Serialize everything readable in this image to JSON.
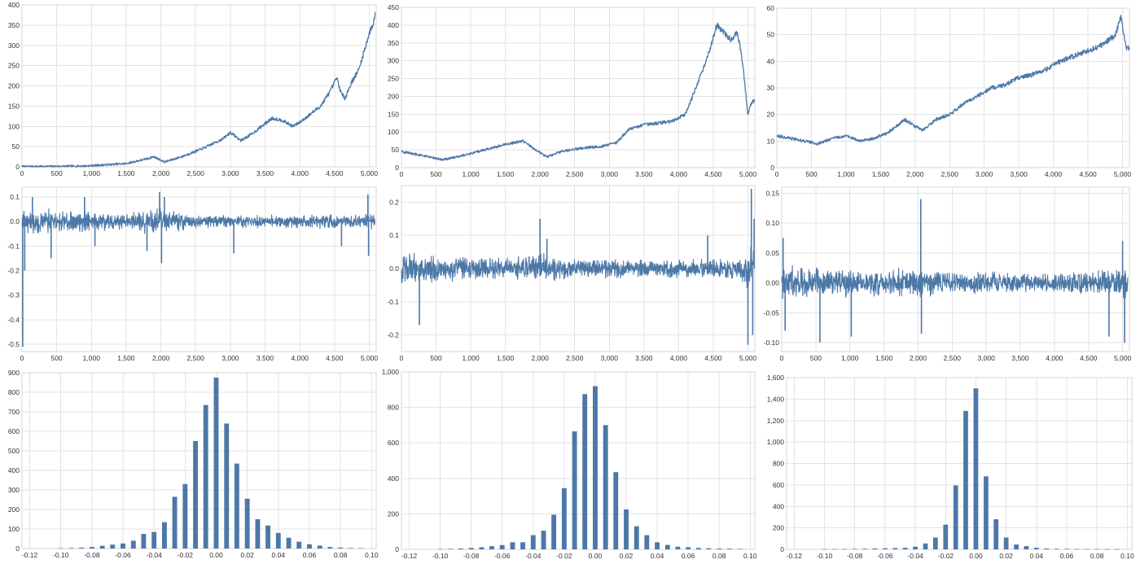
{
  "colors": {
    "series": "#4c78a8",
    "grid": "#e3e3e3",
    "frame": "#d6d6d6",
    "tick_text": "#333333"
  },
  "chart_data": [
    {
      "type": "line",
      "title": "",
      "xlabel": "",
      "ylabel": "",
      "grid": true,
      "xlim": [
        0,
        5100
      ],
      "ylim": [
        0,
        400
      ],
      "xticks": [
        0,
        500,
        1000,
        1500,
        2000,
        2500,
        3000,
        3500,
        4000,
        4500,
        5000
      ],
      "xtick_labels": [
        "0",
        "500",
        "1,000",
        "1,500",
        "2,000",
        "2,500",
        "3,000",
        "3,500",
        "4,000",
        "4,500",
        "5,000"
      ],
      "yticks": [
        0,
        50,
        100,
        150,
        200,
        250,
        300,
        350,
        400
      ],
      "ytick_labels": [
        "0",
        "50",
        "100",
        "150",
        "200",
        "250",
        "300",
        "350",
        "400"
      ],
      "x": [
        0,
        300,
        600,
        900,
        1200,
        1500,
        1800,
        1900,
        2050,
        2300,
        2600,
        2900,
        3000,
        3150,
        3300,
        3450,
        3600,
        3750,
        3900,
        4000,
        4150,
        4300,
        4450,
        4530,
        4600,
        4650,
        4750,
        4850,
        4950,
        5000,
        5050,
        5090
      ],
      "series": [
        {
          "values": [
            1,
            1,
            1.5,
            2,
            5,
            8,
            20,
            25,
            12,
            25,
            45,
            70,
            85,
            65,
            80,
            100,
            120,
            115,
            100,
            110,
            130,
            150,
            190,
            220,
            180,
            170,
            210,
            240,
            300,
            330,
            350,
            380
          ]
        }
      ]
    },
    {
      "type": "line",
      "title": "",
      "xlabel": "",
      "ylabel": "",
      "grid": true,
      "xlim": [
        0,
        5100
      ],
      "ylim": [
        0,
        450
      ],
      "xticks": [
        0,
        500,
        1000,
        1500,
        2000,
        2500,
        3000,
        3500,
        4000,
        4500,
        5000
      ],
      "xtick_labels": [
        "0",
        "500",
        "1,000",
        "1,500",
        "2,000",
        "2,500",
        "3,000",
        "3,500",
        "4,000",
        "4,500",
        "5,000"
      ],
      "yticks": [
        0,
        50,
        100,
        150,
        200,
        250,
        300,
        350,
        400,
        450
      ],
      "ytick_labels": [
        "0",
        "50",
        "100",
        "150",
        "200",
        "250",
        "300",
        "350",
        "400",
        "450"
      ],
      "x": [
        0,
        200,
        400,
        600,
        900,
        1200,
        1500,
        1750,
        1900,
        2100,
        2300,
        2600,
        2900,
        3100,
        3300,
        3500,
        3700,
        3900,
        4100,
        4300,
        4450,
        4550,
        4650,
        4750,
        4850,
        4920,
        5000,
        5050,
        5100
      ],
      "series": [
        {
          "values": [
            45,
            38,
            30,
            22,
            35,
            50,
            65,
            75,
            55,
            30,
            45,
            55,
            60,
            70,
            110,
            120,
            125,
            130,
            150,
            250,
            330,
            400,
            380,
            360,
            380,
            300,
            150,
            180,
            190
          ]
        }
      ]
    },
    {
      "type": "line",
      "title": "",
      "xlabel": "",
      "ylabel": "",
      "grid": true,
      "xlim": [
        0,
        5100
      ],
      "ylim": [
        0,
        60
      ],
      "xticks": [
        0,
        500,
        1000,
        1500,
        2000,
        2500,
        3000,
        3500,
        4000,
        4500,
        5000
      ],
      "xtick_labels": [
        "0",
        "500",
        "1,000",
        "1,500",
        "2,000",
        "2,500",
        "3,000",
        "3,500",
        "4,000",
        "4,500",
        "5,000"
      ],
      "yticks": [
        0,
        10,
        20,
        30,
        40,
        50,
        60
      ],
      "ytick_labels": [
        "0",
        "10",
        "20",
        "30",
        "40",
        "50",
        "60"
      ],
      "x": [
        0,
        200,
        400,
        600,
        800,
        1000,
        1200,
        1400,
        1600,
        1850,
        2100,
        2300,
        2500,
        2700,
        2900,
        3100,
        3300,
        3500,
        3700,
        3900,
        4100,
        4300,
        4500,
        4700,
        4900,
        4980,
        5050,
        5100
      ],
      "series": [
        {
          "values": [
            12,
            11,
            10,
            9,
            11,
            12,
            10,
            11,
            13,
            18,
            14,
            18,
            20,
            24,
            27,
            30,
            31,
            34,
            35,
            37,
            40,
            42,
            44,
            46,
            50,
            57,
            45,
            45
          ]
        }
      ]
    },
    {
      "type": "line",
      "title": "",
      "xlabel": "",
      "ylabel": "",
      "grid": true,
      "xlim": [
        0,
        5100
      ],
      "ylim": [
        -0.53,
        0.14
      ],
      "xticks": [
        0,
        500,
        1000,
        1500,
        2000,
        2500,
        3000,
        3500,
        4000,
        4500,
        5000
      ],
      "xtick_labels": [
        "0",
        "500",
        "1,000",
        "1,500",
        "2,000",
        "2,500",
        "3,000",
        "3,500",
        "4,000",
        "4,500",
        "5,000"
      ],
      "yticks": [
        -0.5,
        -0.4,
        -0.3,
        -0.2,
        -0.1,
        0.0,
        0.1
      ],
      "ytick_labels": [
        "-0.5",
        "-0.4",
        "-0.3",
        "-0.2",
        "-0.1",
        "0.0",
        "0.1"
      ],
      "band": {
        "x": [
          0,
          500,
          1000,
          1500,
          2000,
          2100,
          2500,
          3000,
          3500,
          4000,
          4500,
          5100
        ],
        "amplitude": [
          0.06,
          0.05,
          0.045,
          0.04,
          0.06,
          0.05,
          0.03,
          0.028,
          0.028,
          0.028,
          0.03,
          0.035
        ]
      },
      "spikes": [
        {
          "x": 10,
          "value": -0.51
        },
        {
          "x": 40,
          "value": -0.2
        },
        {
          "x": 150,
          "value": 0.1
        },
        {
          "x": 420,
          "value": -0.15
        },
        {
          "x": 900,
          "value": 0.1
        },
        {
          "x": 1050,
          "value": -0.1
        },
        {
          "x": 1800,
          "value": -0.12
        },
        {
          "x": 1980,
          "value": 0.12
        },
        {
          "x": 2010,
          "value": -0.17
        },
        {
          "x": 2050,
          "value": 0.1
        },
        {
          "x": 3050,
          "value": -0.13
        },
        {
          "x": 4600,
          "value": -0.1
        },
        {
          "x": 4980,
          "value": 0.11
        },
        {
          "x": 4990,
          "value": -0.14
        }
      ],
      "series": [
        {
          "values": []
        }
      ]
    },
    {
      "type": "line",
      "title": "",
      "xlabel": "",
      "ylabel": "",
      "grid": true,
      "xlim": [
        0,
        5100
      ],
      "ylim": [
        -0.25,
        0.25
      ],
      "xticks": [
        0,
        500,
        1000,
        1500,
        2000,
        2500,
        3000,
        3500,
        4000,
        4500,
        5000
      ],
      "xtick_labels": [
        "0",
        "500",
        "1,000",
        "1,500",
        "2,000",
        "2,500",
        "3,000",
        "3,500",
        "4,000",
        "4,500",
        "5,000"
      ],
      "yticks": [
        -0.2,
        -0.1,
        0.0,
        0.1,
        0.2
      ],
      "ytick_labels": [
        "-0.2",
        "-0.1",
        "0.0",
        "0.1",
        "0.2"
      ],
      "band": {
        "x": [
          0,
          500,
          1000,
          1500,
          2000,
          2200,
          2500,
          3000,
          3500,
          4000,
          4500,
          4900,
          5000,
          5100
        ],
        "amplitude": [
          0.06,
          0.045,
          0.04,
          0.035,
          0.05,
          0.04,
          0.03,
          0.03,
          0.03,
          0.03,
          0.03,
          0.04,
          0.09,
          0.06
        ]
      },
      "spikes": [
        {
          "x": 260,
          "value": -0.17
        },
        {
          "x": 2000,
          "value": 0.15
        },
        {
          "x": 2100,
          "value": 0.09
        },
        {
          "x": 4420,
          "value": 0.1
        },
        {
          "x": 5000,
          "value": -0.23
        },
        {
          "x": 5050,
          "value": 0.24
        },
        {
          "x": 5070,
          "value": -0.2
        },
        {
          "x": 5090,
          "value": 0.15
        }
      ],
      "series": [
        {
          "values": []
        }
      ]
    },
    {
      "type": "line",
      "title": "",
      "xlabel": "",
      "ylabel": "",
      "grid": true,
      "xlim": [
        0,
        5100
      ],
      "ylim": [
        -0.115,
        0.16
      ],
      "xticks": [
        0,
        500,
        1000,
        1500,
        2000,
        2500,
        3000,
        3500,
        4000,
        4500,
        5000
      ],
      "xtick_labels": [
        "0",
        "500",
        "1,000",
        "1,500",
        "2,000",
        "2,500",
        "3,000",
        "3,500",
        "4,000",
        "4,500",
        "5,000"
      ],
      "yticks": [
        -0.1,
        -0.05,
        0.0,
        0.05,
        0.1,
        0.15
      ],
      "ytick_labels": [
        "-0.10",
        "-0.05",
        "0.00",
        "0.05",
        "0.10",
        "0.15"
      ],
      "band": {
        "x": [
          0,
          500,
          1000,
          1500,
          2000,
          2100,
          2500,
          3000,
          3500,
          4000,
          4500,
          5100
        ],
        "amplitude": [
          0.035,
          0.03,
          0.025,
          0.022,
          0.03,
          0.025,
          0.02,
          0.02,
          0.018,
          0.018,
          0.02,
          0.03
        ]
      },
      "spikes": [
        {
          "x": 20,
          "value": 0.075
        },
        {
          "x": 50,
          "value": -0.08
        },
        {
          "x": 560,
          "value": -0.1
        },
        {
          "x": 1020,
          "value": -0.09
        },
        {
          "x": 2040,
          "value": 0.14
        },
        {
          "x": 2050,
          "value": -0.085
        },
        {
          "x": 4800,
          "value": -0.09
        },
        {
          "x": 5000,
          "value": 0.07
        },
        {
          "x": 5030,
          "value": -0.1
        }
      ],
      "series": [
        {
          "values": []
        }
      ]
    },
    {
      "type": "bar",
      "title": "",
      "xlabel": "",
      "ylabel": "",
      "grid": true,
      "xlim": [
        -0.125,
        0.103
      ],
      "ylim": [
        0,
        900
      ],
      "xticks": [
        -0.12,
        -0.1,
        -0.08,
        -0.06,
        -0.04,
        -0.02,
        0.0,
        0.02,
        0.04,
        0.06,
        0.08,
        0.1
      ],
      "xtick_labels": [
        "-0.12",
        "-0.10",
        "-0.08",
        "-0.06",
        "-0.04",
        "-0.02",
        "0.00",
        "0.02",
        "0.04",
        "0.06",
        "0.08",
        "0.10"
      ],
      "yticks": [
        0,
        100,
        200,
        300,
        400,
        500,
        600,
        700,
        800,
        900
      ],
      "ytick_labels": [
        "0",
        "100",
        "200",
        "300",
        "400",
        "500",
        "600",
        "700",
        "800",
        "900"
      ],
      "bin_width": 0.0067,
      "x": [
        -0.1,
        -0.0933,
        -0.0867,
        -0.08,
        -0.0733,
        -0.0667,
        -0.06,
        -0.0533,
        -0.0467,
        -0.04,
        -0.0333,
        -0.0267,
        -0.02,
        -0.0133,
        -0.0067,
        0.0,
        0.0067,
        0.0133,
        0.02,
        0.0267,
        0.0333,
        0.04,
        0.0467,
        0.0533,
        0.06,
        0.0667,
        0.0733,
        0.08,
        0.0867,
        0.0933
      ],
      "series": [
        {
          "values": [
            2,
            3,
            5,
            8,
            14,
            20,
            26,
            40,
            75,
            85,
            135,
            265,
            330,
            550,
            735,
            875,
            640,
            435,
            255,
            150,
            118,
            80,
            55,
            35,
            22,
            15,
            8,
            5,
            3,
            2
          ]
        }
      ]
    },
    {
      "type": "bar",
      "title": "",
      "xlabel": "",
      "ylabel": "",
      "grid": true,
      "xlim": [
        -0.125,
        0.103
      ],
      "ylim": [
        0,
        1000
      ],
      "xticks": [
        -0.12,
        -0.1,
        -0.08,
        -0.06,
        -0.04,
        -0.02,
        0.0,
        0.02,
        0.04,
        0.06,
        0.08,
        0.1
      ],
      "xtick_labels": [
        "-0.12",
        "-0.10",
        "-0.08",
        "-0.06",
        "-0.04",
        "-0.02",
        "0.00",
        "0.02",
        "0.04",
        "0.06",
        "0.08",
        "0.10"
      ],
      "yticks": [
        0,
        200,
        400,
        600,
        800,
        1000
      ],
      "ytick_labels": [
        "0",
        "200",
        "400",
        "600",
        "800",
        "1,000"
      ],
      "bin_width": 0.0067,
      "x": [
        -0.1,
        -0.0933,
        -0.0867,
        -0.08,
        -0.0733,
        -0.0667,
        -0.06,
        -0.0533,
        -0.0467,
        -0.04,
        -0.0333,
        -0.0267,
        -0.02,
        -0.0133,
        -0.0067,
        0.0,
        0.0067,
        0.0133,
        0.02,
        0.0267,
        0.0333,
        0.04,
        0.0467,
        0.0533,
        0.06,
        0.0667,
        0.0733,
        0.08,
        0.0867,
        0.0933
      ],
      "series": [
        {
          "values": [
            2,
            3,
            5,
            8,
            12,
            18,
            24,
            40,
            40,
            80,
            105,
            195,
            345,
            665,
            875,
            920,
            700,
            435,
            225,
            130,
            80,
            40,
            25,
            15,
            12,
            8,
            6,
            5,
            4,
            3
          ]
        }
      ]
    },
    {
      "type": "bar",
      "title": "",
      "xlabel": "",
      "ylabel": "",
      "grid": true,
      "xlim": [
        -0.125,
        0.103
      ],
      "ylim": [
        0,
        1600
      ],
      "xticks": [
        -0.12,
        -0.1,
        -0.08,
        -0.06,
        -0.04,
        -0.02,
        0.0,
        0.02,
        0.04,
        0.06,
        0.08,
        0.1
      ],
      "xtick_labels": [
        "-0.12",
        "-0.10",
        "-0.08",
        "-0.06",
        "-0.04",
        "-0.02",
        "0.00",
        "0.02",
        "0.04",
        "0.06",
        "0.08",
        "0.10"
      ],
      "yticks": [
        0,
        200,
        400,
        600,
        800,
        1000,
        1200,
        1400,
        1600
      ],
      "ytick_labels": [
        "0",
        "200",
        "400",
        "600",
        "800",
        "1,000",
        "1,200",
        "1,400",
        "1,600"
      ],
      "bin_width": 0.0067,
      "x": [
        -0.1,
        -0.0933,
        -0.0867,
        -0.08,
        -0.0733,
        -0.0667,
        -0.06,
        -0.0533,
        -0.0467,
        -0.04,
        -0.0333,
        -0.0267,
        -0.02,
        -0.0133,
        -0.0067,
        0.0,
        0.0067,
        0.0133,
        0.02,
        0.0267,
        0.0333,
        0.04,
        0.0467,
        0.0533,
        0.06,
        0.0667,
        0.0733,
        0.08,
        0.0867,
        0.0933
      ],
      "series": [
        {
          "values": [
            2,
            3,
            4,
            5,
            6,
            8,
            10,
            12,
            15,
            25,
            55,
            110,
            230,
            595,
            1290,
            1500,
            680,
            280,
            110,
            45,
            30,
            15,
            8,
            6,
            5,
            4,
            3,
            3,
            2,
            2
          ]
        }
      ]
    }
  ]
}
